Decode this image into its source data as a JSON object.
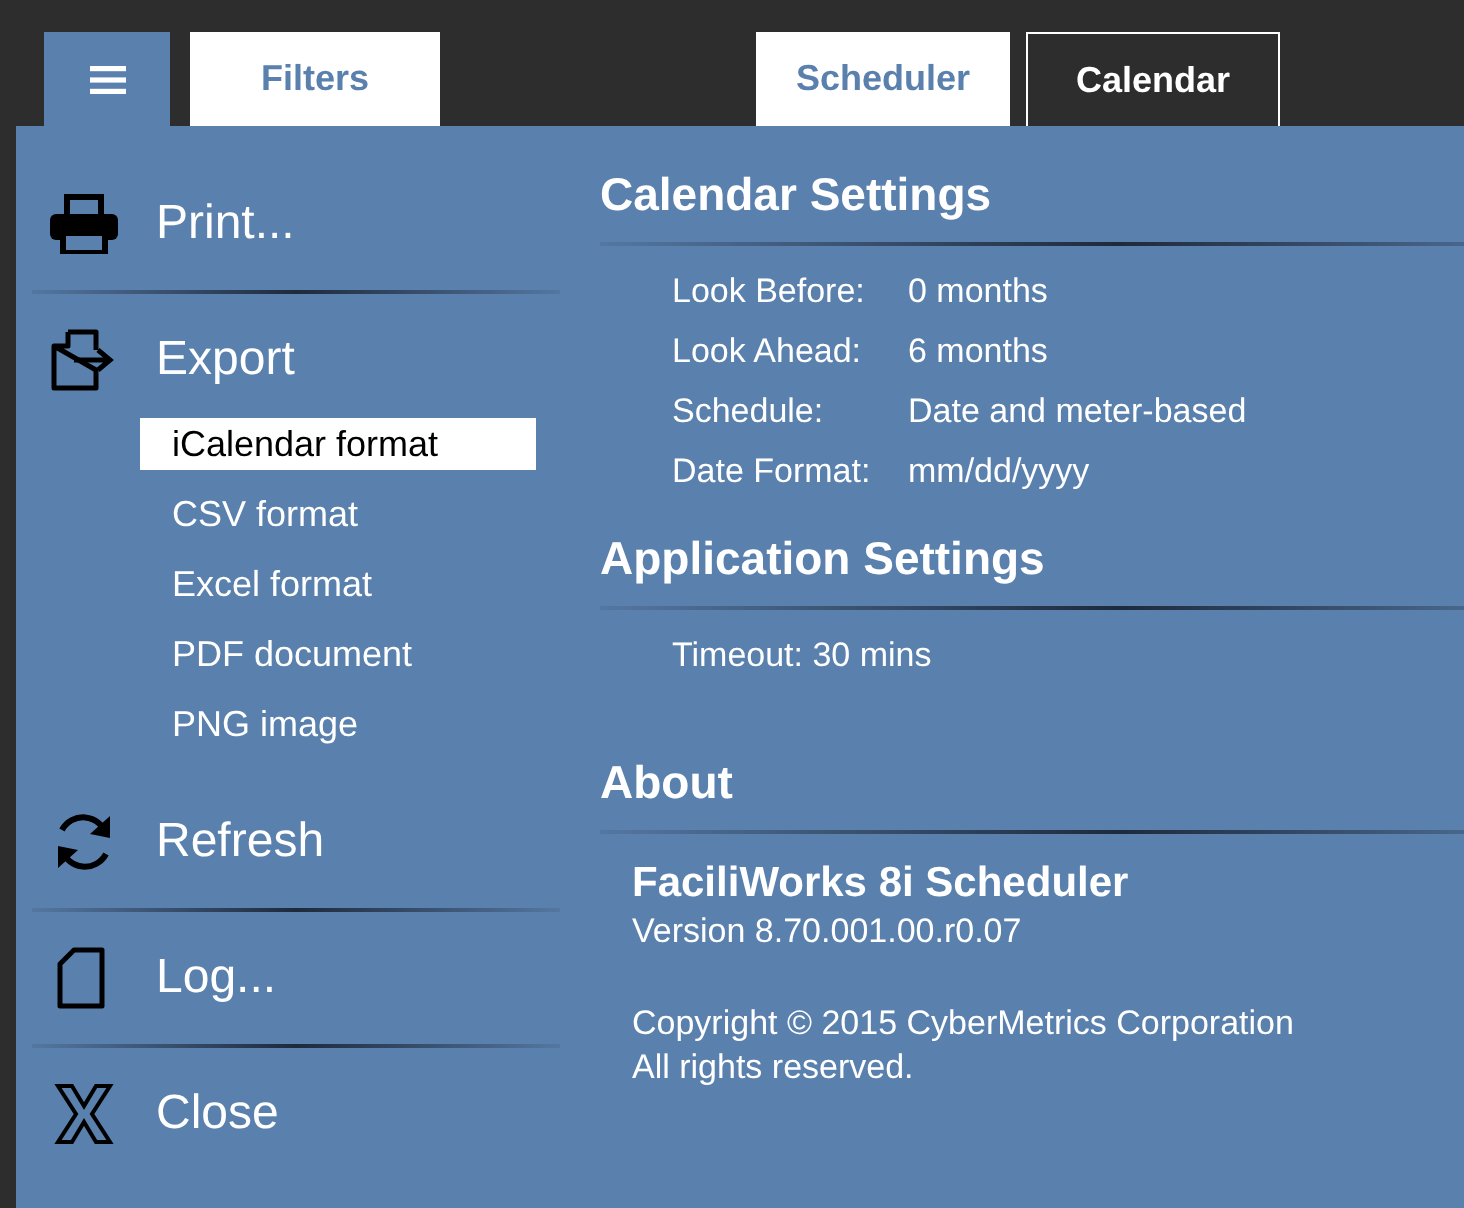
{
  "top_bar": {
    "menu_button": {
      "open": true
    },
    "left_tabs": [
      {
        "label": "Filters",
        "selected": false
      }
    ],
    "view_tabs": [
      {
        "label": "Scheduler",
        "selected": false
      },
      {
        "label": "Calendar",
        "selected": true
      }
    ]
  },
  "menu": [
    {
      "kind": "print",
      "label": "Print..."
    },
    {
      "kind": "export",
      "label": "Export",
      "children": [
        {
          "label": "iCalendar format",
          "selected": true
        },
        {
          "label": "CSV format",
          "selected": false
        },
        {
          "label": "Excel format",
          "selected": false
        },
        {
          "label": "PDF document",
          "selected": false
        },
        {
          "label": "PNG image",
          "selected": false
        }
      ]
    },
    {
      "kind": "refresh",
      "label": "Refresh"
    },
    {
      "kind": "log",
      "label": "Log..."
    },
    {
      "kind": "close",
      "label": "Close"
    }
  ],
  "sections": [
    {
      "title": "Calendar Settings",
      "kind": "table",
      "rows": [
        {
          "label": "Look Before:",
          "value": "0 months"
        },
        {
          "label": "Look Ahead:",
          "value": "6 months"
        },
        {
          "label": "Schedule:",
          "value": "Date and meter-based"
        },
        {
          "label": "Date Format:",
          "value": "mm/dd/yyyy"
        }
      ]
    },
    {
      "title": "Application Settings",
      "kind": "lines",
      "lines": [
        "Timeout: 30 mins"
      ]
    },
    {
      "title": "About",
      "kind": "about",
      "product": "FaciliWorks 8i Scheduler",
      "version": "Version 8.70.001.00.r0.07",
      "copyright": [
        "Copyright © 2015 CyberMetrics Corporation",
        "All rights reserved."
      ]
    }
  ]
}
